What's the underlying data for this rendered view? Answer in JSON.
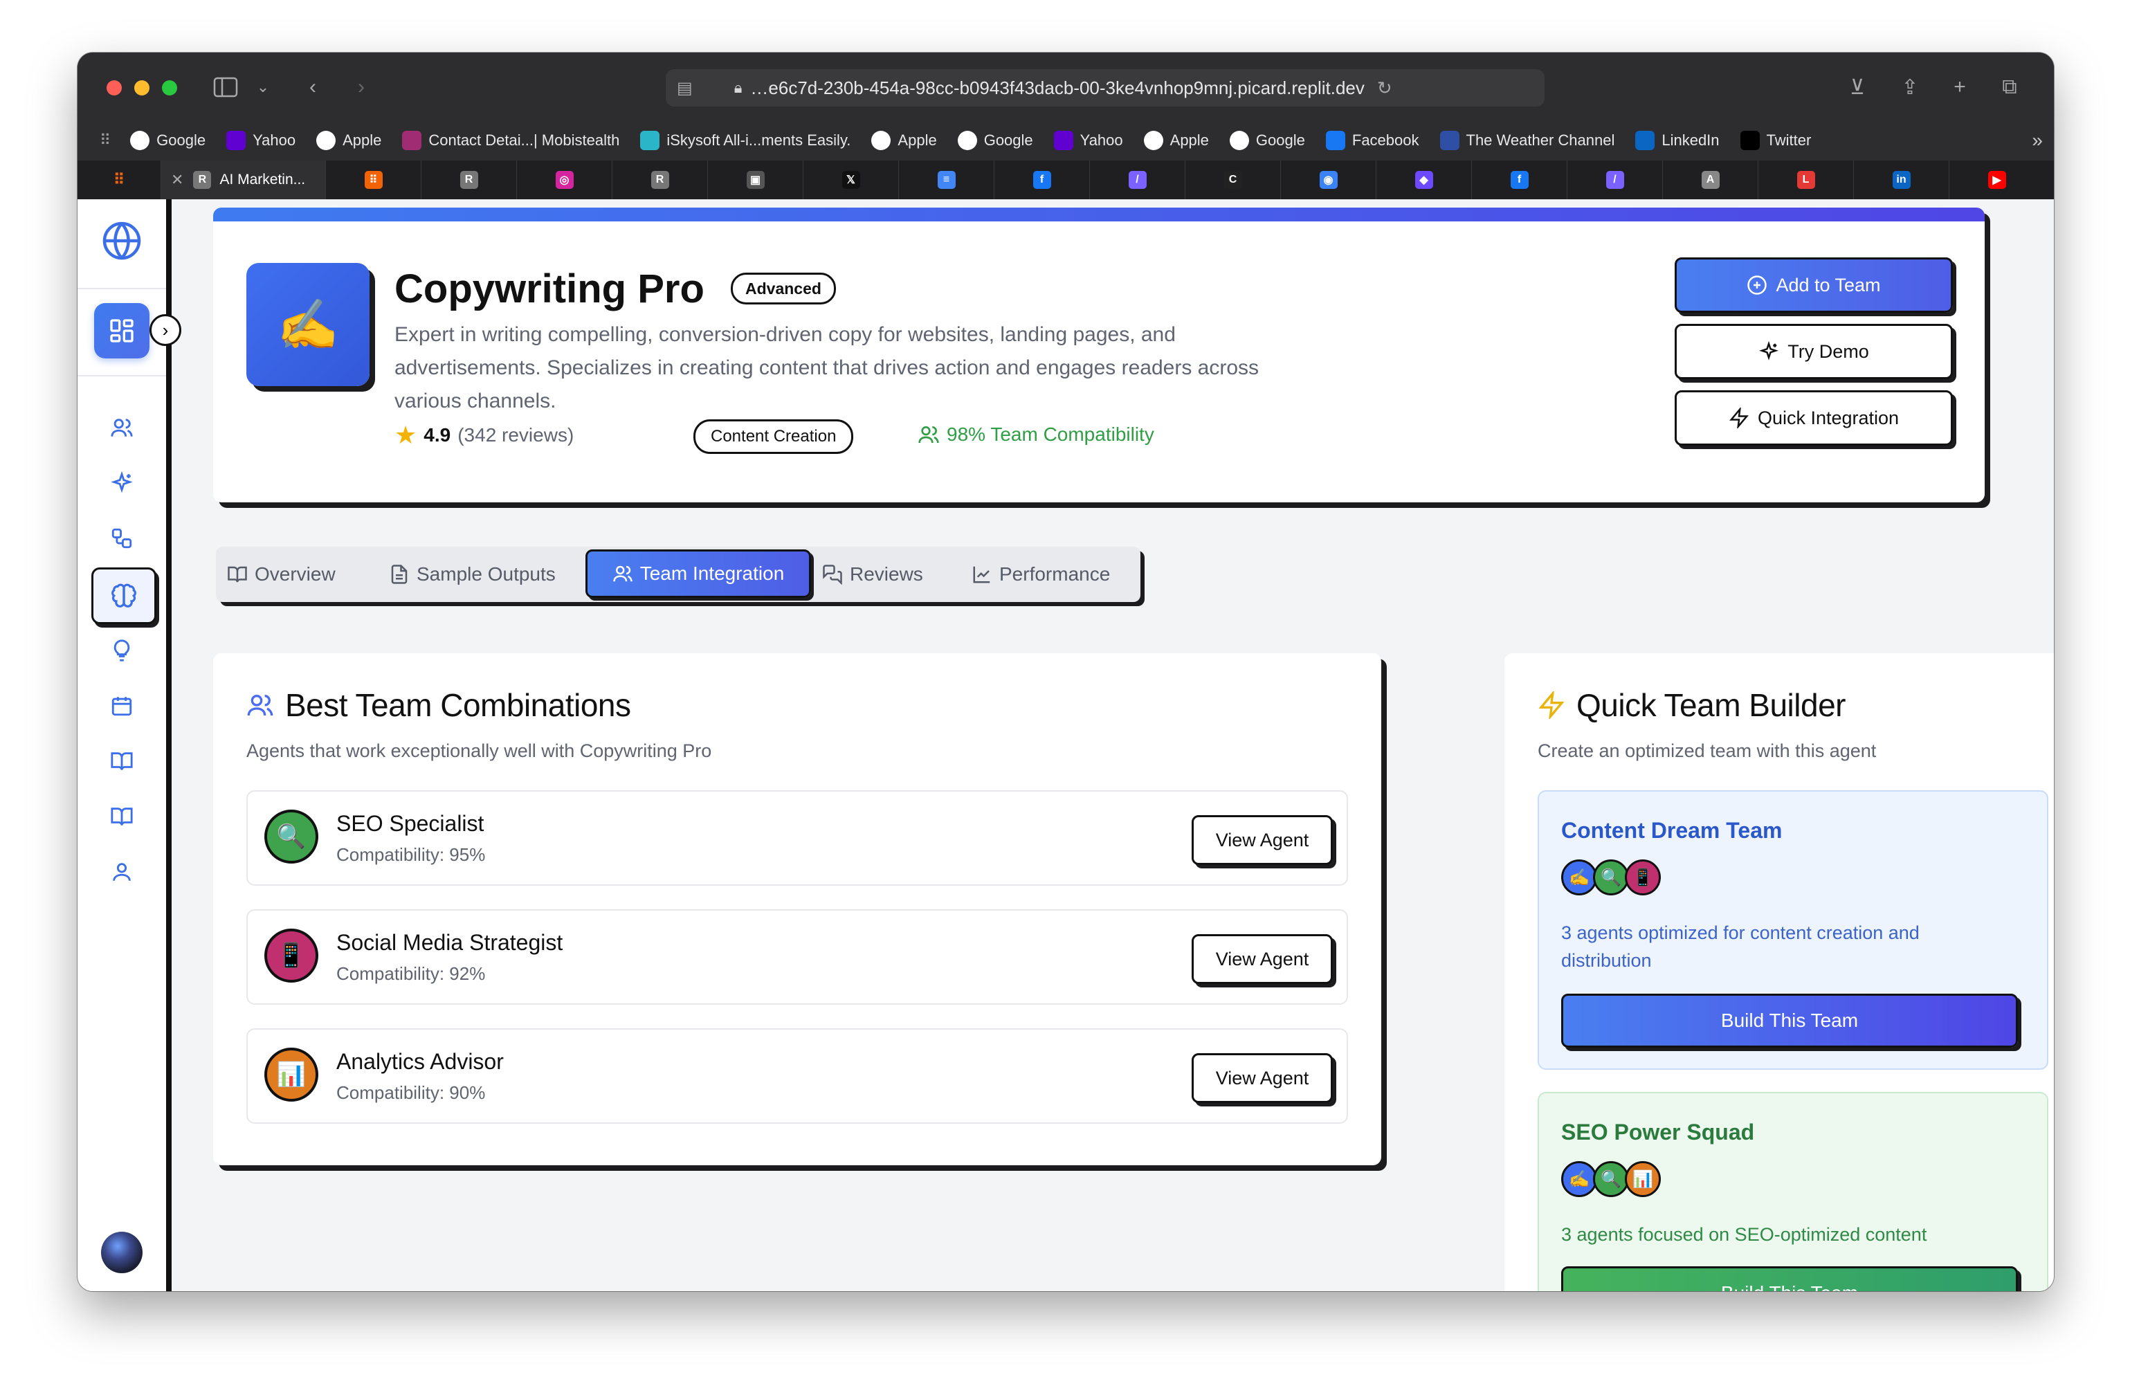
{
  "browser": {
    "url": "…e6c7d-230b-454a-98cc-b0943f43dacb-00-3ke4vnhop9mnj.picard.replit.dev",
    "bookmarks": [
      {
        "label": "Google",
        "icon": "google-icon",
        "color": "#ffffff"
      },
      {
        "label": "Yahoo",
        "icon": "yahoo-icon",
        "color": "#6001d2"
      },
      {
        "label": "Apple",
        "icon": "apple-icon",
        "color": "#ffffff"
      },
      {
        "label": "Contact Detai...| Mobistealth",
        "icon": "mobistealth-icon",
        "color": "#a02d73"
      },
      {
        "label": "iSkysoft All-i...ments Easily.",
        "icon": "iskysoft-icon",
        "color": "#2bb5c8"
      },
      {
        "label": "Apple",
        "icon": "apple-icon",
        "color": "#ffffff"
      },
      {
        "label": "Google",
        "icon": "google-icon",
        "color": "#ffffff"
      },
      {
        "label": "Yahoo",
        "icon": "yahoo-icon",
        "color": "#6001d2"
      },
      {
        "label": "Apple",
        "icon": "apple-icon",
        "color": "#ffffff"
      },
      {
        "label": "Google",
        "icon": "google-icon",
        "color": "#ffffff"
      },
      {
        "label": "Facebook",
        "icon": "facebook-icon",
        "color": "#1877f2"
      },
      {
        "label": "The Weather Channel",
        "icon": "weather-channel-icon",
        "color": "#2e4fa3"
      },
      {
        "label": "LinkedIn",
        "icon": "linkedin-icon",
        "color": "#0a66c2"
      },
      {
        "label": "Twitter",
        "icon": "x-twitter-icon",
        "color": "#000000"
      }
    ],
    "active_tab": "AI Marketin...",
    "tab_icons": [
      {
        "name": "replit-icon",
        "glyph": "⠿",
        "color": "#f26207"
      },
      {
        "name": "r-icon",
        "glyph": "R",
        "color": "#777777"
      },
      {
        "name": "instagram-icon",
        "glyph": "◎",
        "color": "#d6249f"
      },
      {
        "name": "r-icon",
        "glyph": "R",
        "color": "#777777"
      },
      {
        "name": "chat-icon",
        "glyph": "▣",
        "color": "#555555"
      },
      {
        "name": "x-icon",
        "glyph": "𝕏",
        "color": "#111111"
      },
      {
        "name": "docs-icon",
        "glyph": "≡",
        "color": "#4285f4"
      },
      {
        "name": "facebook-icon",
        "glyph": "f",
        "color": "#1877f2"
      },
      {
        "name": "pen-icon",
        "glyph": "/",
        "color": "#7b61ff"
      },
      {
        "name": "c-icon",
        "glyph": "C",
        "color": "#222222"
      },
      {
        "name": "q-icon",
        "glyph": "◉",
        "color": "#3b82f6"
      },
      {
        "name": "app-icon",
        "glyph": "◆",
        "color": "#6d4aff"
      },
      {
        "name": "facebook-icon",
        "glyph": "f",
        "color": "#1877f2"
      },
      {
        "name": "pen-icon",
        "glyph": "/",
        "color": "#7b61ff"
      },
      {
        "name": "a-icon",
        "glyph": "A",
        "color": "#888888"
      },
      {
        "name": "l-icon",
        "glyph": "L",
        "color": "#e53935"
      },
      {
        "name": "linkedin-icon",
        "glyph": "in",
        "color": "#0a66c2"
      },
      {
        "name": "youtube-icon",
        "glyph": "▶",
        "color": "#ff0000"
      }
    ]
  },
  "agent": {
    "emoji": "✍️",
    "name": "Copywriting Pro",
    "level_badge": "Advanced",
    "description": "Expert in writing compelling, conversion-driven copy for websites, landing pages, and advertisements. Specializes in creating content that drives action and engages readers across various channels.",
    "rating": "4.9",
    "reviews": "(342 reviews)",
    "category": "Content Creation",
    "compatibility": "98% Team Compatibility",
    "actions": {
      "add": "Add to Team",
      "demo": "Try Demo",
      "integration": "Quick Integration"
    }
  },
  "tabs": [
    {
      "label": "Overview",
      "icon": "book-open-icon"
    },
    {
      "label": "Sample Outputs",
      "icon": "file-text-icon"
    },
    {
      "label": "Team Integration",
      "icon": "users-icon"
    },
    {
      "label": "Reviews",
      "icon": "messages-icon"
    },
    {
      "label": "Performance",
      "icon": "line-chart-icon"
    }
  ],
  "active_tab_index": 2,
  "combinations": {
    "title": "Best Team Combinations",
    "subtitle": "Agents that work exceptionally well with Copywriting Pro",
    "items": [
      {
        "name": "SEO Specialist",
        "compat": "Compatibility: 95%",
        "emoji": "🔍",
        "color": "#3fa34d",
        "button": "View Agent"
      },
      {
        "name": "Social Media Strategist",
        "compat": "Compatibility: 92%",
        "emoji": "📱",
        "color": "#c0306e",
        "button": "View Agent"
      },
      {
        "name": "Analytics Advisor",
        "compat": "Compatibility: 90%",
        "emoji": "📊",
        "color": "#e07b1f",
        "button": "View Agent"
      }
    ]
  },
  "builder": {
    "title": "Quick Team Builder",
    "subtitle": "Create an optimized team with this agent",
    "teams": [
      {
        "name": "Content Dream Team",
        "desc": "3 agents optimized for content creation and distribution",
        "button": "Build This Team",
        "emojis": [
          "✍️",
          "🔍",
          "📱"
        ]
      },
      {
        "name": "SEO Power Squad",
        "desc": "3 agents focused on SEO-optimized content",
        "button": "Build This Team",
        "emojis": [
          "✍️",
          "🔍",
          "📊"
        ]
      }
    ]
  },
  "colors": {
    "primary_gradient_start": "#3f7bf0",
    "primary_gradient_end": "#4f46e5",
    "green": "#2f9e44",
    "team_blue_bg": "#eef4fe",
    "team_green_bg": "#edf8ef"
  }
}
